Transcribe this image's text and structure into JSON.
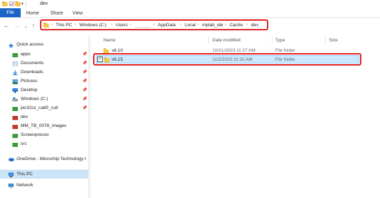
{
  "titlebar": {
    "title": "dev"
  },
  "ribbon": {
    "tabs": [
      "File",
      "Home",
      "Share",
      "View"
    ]
  },
  "address": {
    "crumbs": [
      "This PC",
      "Windows (C:)",
      "Users",
      "______",
      "AppData",
      "Local",
      "mplab_ide",
      "Cache",
      "dev"
    ]
  },
  "sidebar": {
    "quick_access": "Quick access",
    "items": [
      {
        "label": "apps",
        "icon": "folder-green-icon",
        "pinned": true
      },
      {
        "label": "Documents",
        "icon": "documents-icon",
        "pinned": true
      },
      {
        "label": "Downloads",
        "icon": "downloads-icon",
        "pinned": true
      },
      {
        "label": "Pictures",
        "icon": "pictures-icon",
        "pinned": true
      },
      {
        "label": "Desktop",
        "icon": "desktop-icon",
        "pinned": true
      },
      {
        "label": "Windows (C:)",
        "icon": "drive-icon",
        "pinned": true
      },
      {
        "label": "pic32cz_ca80_cult",
        "icon": "folder-green-icon",
        "pinned": true
      },
      {
        "label": "dev",
        "icon": "folder-icon",
        "pinned": false
      },
      {
        "label": "MM_TB_0078_images",
        "icon": "folder-icon",
        "pinned": false
      },
      {
        "label": "Screenpresso",
        "icon": "folder-green-icon",
        "pinned": false
      },
      {
        "label": "src",
        "icon": "folder-green-icon",
        "pinned": false
      }
    ],
    "onedrive": "OneDrive - Microchip Technology I",
    "thispc": "This PC",
    "network": "Network"
  },
  "list": {
    "columns": [
      "Name",
      "Date modified",
      "Type",
      "Size"
    ],
    "rows": [
      {
        "name": "v6.10",
        "date": "10/21/2023 11:27 AM",
        "type": "File folder",
        "selected": false
      },
      {
        "name": "v6.15",
        "date": "11/2/2023 11:10 AM",
        "type": "File folder",
        "selected": true
      }
    ]
  },
  "colors": {
    "accent": "#1a64c8",
    "highlight": "#e01e1e",
    "selection": "#cce8ff"
  }
}
